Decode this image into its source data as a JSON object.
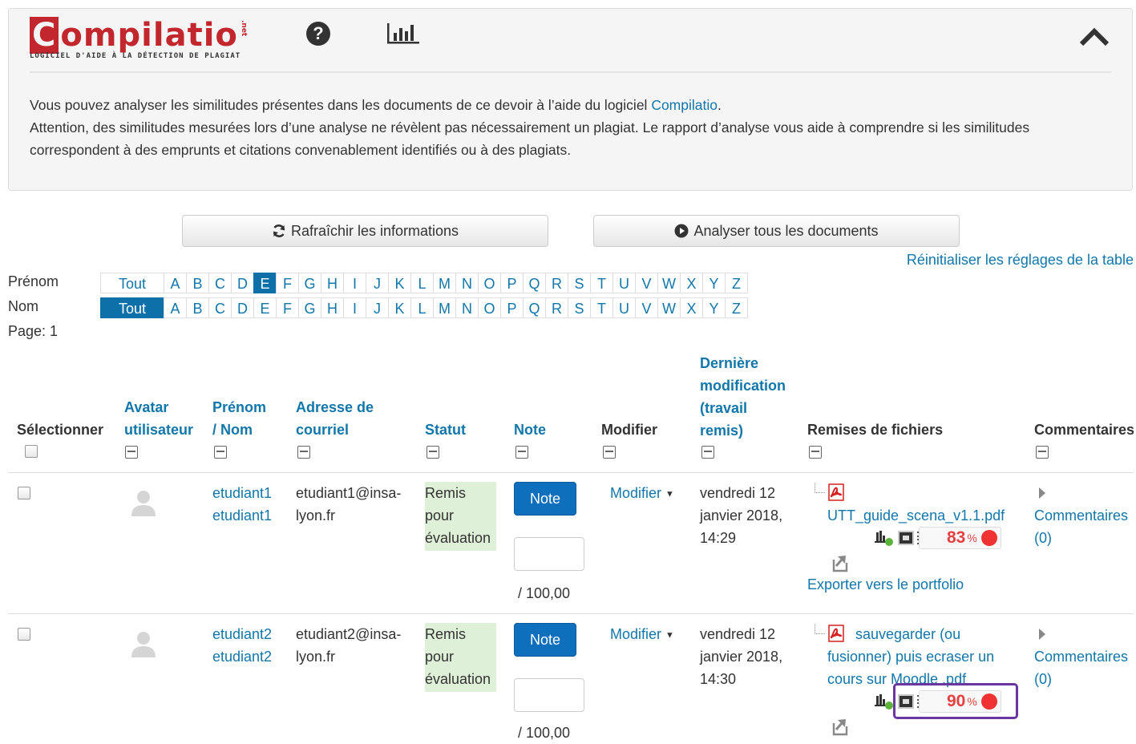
{
  "compilatio": {
    "logo_text": "ompilatio",
    "logo_letter": "C",
    "logo_net": ".net",
    "tagline": "LOGICIEL D'AIDE À LA DÉTECTION DE PLAGIAT",
    "help_glyph": "?",
    "intro_prefix": "Vous pouvez analyser les similitudes présentes dans les documents de ce devoir à l’aide du logiciel ",
    "intro_link": "Compilatio",
    "intro_suffix": ".",
    "warning": "Attention, des similitudes mesurées lors d’une analyse ne révèlent pas nécessairement un plagiat. Le rapport d’analyse vous aide à comprendre si les similitudes correspondent à des emprunts et citations convenablement identifiés ou à des plagiats.",
    "accent_color": "#c1272d"
  },
  "actions": {
    "refresh_label": "Rafraîchir les informations",
    "analyze_label": "Analyser tous les documents",
    "reset_label": "Réinitialiser les réglages de la table"
  },
  "filters": {
    "firstname_label": "Prénom",
    "lastname_label": "Nom",
    "all_label": "Tout",
    "letters": [
      "A",
      "B",
      "C",
      "D",
      "E",
      "F",
      "G",
      "H",
      "I",
      "J",
      "K",
      "L",
      "M",
      "N",
      "O",
      "P",
      "Q",
      "R",
      "S",
      "T",
      "U",
      "V",
      "W",
      "X",
      "Y",
      "Z"
    ],
    "firstname_active": "E",
    "lastname_active": "Tout",
    "page_label": "Page: 1"
  },
  "table": {
    "headers": {
      "select": "Sélectionner",
      "avatar": [
        "Avatar",
        "utilisateur"
      ],
      "name": [
        "Prénom",
        "/ Nom"
      ],
      "email": [
        "Adresse de",
        "courriel"
      ],
      "status": "Statut",
      "grade": "Note",
      "edit": "Modifier",
      "modified": [
        "Dernière",
        "modification",
        "(travail",
        "remis)"
      ],
      "files": "Remises de fichiers",
      "comments": "Commentaires"
    },
    "rows": [
      {
        "firstname": "etudiant1",
        "lastname": "etudiant1",
        "email": [
          "etudiant1@insa-",
          "lyon.fr"
        ],
        "status": [
          "Remis",
          "pour",
          "évaluation"
        ],
        "grade_button": "Note",
        "grade_max": "/ 100,00",
        "edit_label": "Modifier",
        "modified": [
          "vendredi 12",
          "janvier 2018,",
          "14:29"
        ],
        "file": [
          "UTT_guide_scena_v1.1.pdf"
        ],
        "score": "83",
        "score_unit": "%",
        "export_label": "Exporter vers le portfolio",
        "comments": [
          "Commentaires",
          "(0)"
        ]
      },
      {
        "firstname": "etudiant2",
        "lastname": "etudiant2",
        "email": [
          "etudiant2@insa-",
          "lyon.fr"
        ],
        "status": [
          "Remis",
          "pour",
          "évaluation"
        ],
        "grade_button": "Note",
        "grade_max": "/ 100,00",
        "edit_label": "Modifier",
        "modified": [
          "vendredi 12",
          "janvier 2018,",
          "14:30"
        ],
        "file": [
          "sauvegarder (ou",
          "fusionner) puis ecraser un",
          "cours sur Moodle .pdf"
        ],
        "score": "90",
        "score_unit": "%",
        "comments": [
          "Commentaires",
          "(0)"
        ]
      }
    ]
  }
}
